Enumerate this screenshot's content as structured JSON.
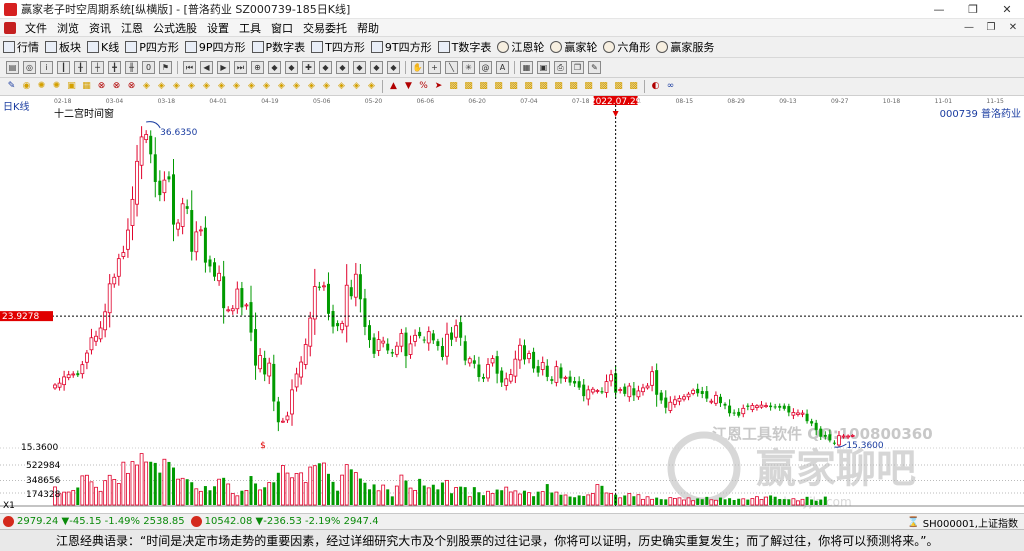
{
  "window": {
    "title": "赢家老子时空周期系统[纵横版] - [普洛药业  SZ000739-185日K线]",
    "buttons": [
      "—",
      "❐",
      "✕"
    ]
  },
  "menubar": {
    "items": [
      "文件",
      "浏览",
      "资讯",
      "江恩",
      "公式选股",
      "设置",
      "工具",
      "窗口",
      "交易委托",
      "帮助"
    ],
    "mdi_buttons": [
      "—",
      "❐",
      "✕"
    ]
  },
  "toolbar1": {
    "items": [
      {
        "icon": "grid-icon",
        "label": "行情"
      },
      {
        "icon": "blocks-icon",
        "label": "板块"
      },
      {
        "icon": "candle-icon",
        "label": "K线"
      },
      {
        "icon": "square-p-icon",
        "label": "P四方形"
      },
      {
        "icon": "square-9p-icon",
        "label": "9P四方形"
      },
      {
        "icon": "square-pn-icon",
        "label": "P数字表"
      },
      {
        "icon": "square-t-icon",
        "label": "T四方形"
      },
      {
        "icon": "square-9t-icon",
        "label": "9T四方形"
      },
      {
        "icon": "square-tn-icon",
        "label": "T数字表"
      },
      {
        "icon": "wheel-icon",
        "label": "江恩轮"
      },
      {
        "icon": "wheel2-icon",
        "label": "赢家轮"
      },
      {
        "icon": "hexagon-icon",
        "label": "六角形"
      },
      {
        "icon": "service-icon",
        "label": "赢家服务"
      }
    ]
  },
  "toolbar2": {
    "zero_label": "0"
  },
  "chart": {
    "period_label": "日K线",
    "window_title": "十二宫时间窗",
    "stock_label": "000739 普洛药业",
    "cursor_date": "2022.07.29",
    "cursor_price": "23.9278",
    "high_label": "36.6350",
    "low_label": "15.3600",
    "price_axis_label": "15.3600",
    "vol_labels": [
      "522984",
      "348656",
      "174328"
    ],
    "vol_unit": "X1",
    "watermark_text": "江恩工具软件 QQ:100800360",
    "watermark_brand": "赢家聊吧",
    "watermark_url": "liaoba.yjlz.com",
    "date_ticks": [
      "02-18",
      "03-04",
      "03-18",
      "04-01",
      "04-19",
      "05-06",
      "05-20",
      "06-06",
      "06-20",
      "07-04",
      "07-18",
      "08-01",
      "08-15",
      "08-29",
      "09-13",
      "09-27",
      "10-18",
      "11-01",
      "11-15"
    ],
    "colors": {
      "up": "#e0002a",
      "down": "#009a00",
      "crosshair": "#000000",
      "price_tag": "#e00000"
    }
  },
  "chart_data": {
    "type": "candlestick",
    "ylim": [
      15.36,
      36.635
    ],
    "closes": [
      19.42,
      19.54,
      19.95,
      20.09,
      20.14,
      20.06,
      20.75,
      21.51,
      22.51,
      22.61,
      23.15,
      24.21,
      26.04,
      26.47,
      27.69,
      28.09,
      29.56,
      31.57,
      34.06,
      35.66,
      35.82,
      34.52,
      32.71,
      31.85,
      32.83,
      32.88,
      29.92,
      30.02,
      31.28,
      30.95,
      28.14,
      29.44,
      29.57,
      27.43,
      27.18,
      26.51,
      26.73,
      24.45,
      24.34,
      24.41,
      25.7,
      24.5,
      24.66,
      22.85,
      20.69,
      21.35,
      20.11,
      20.85,
      18.34,
      16.98,
      17.05,
      17.39,
      19.1,
      20.14,
      20.92,
      22.07,
      23.8,
      25.86,
      25.78,
      25.91,
      24.08,
      23.24,
      23.27,
      23.45,
      25.95,
      25.23,
      26.67,
      25.03,
      23.22,
      22.36,
      21.46,
      22.39,
      22.29,
      21.68,
      21.48,
      21.96,
      22.79,
      21.31,
      22.11,
      22.67,
      22.62,
      22.34,
      22.91,
      22.34,
      21.97,
      21.25,
      22.74,
      22.38,
      23.3,
      22.51,
      21.02,
      21.14,
      20.81,
      19.94,
      19.83,
      20.76,
      21.15,
      20.16,
      19.58,
      19.82,
      20.1,
      21.11,
      22.02,
      21.09,
      21.48,
      20.5,
      20.23,
      20.89,
      19.95,
      19.69,
      20.62,
      19.85,
      19.92,
      19.58,
      19.52,
      19.25,
      18.69,
      19.1,
      19.14,
      19.06,
      18.93,
      19.64,
      20.09,
      18.92,
      19.12,
      18.84,
      19.35,
      18.74,
      19.03,
      19.23,
      19.35,
      20.29,
      18.78,
      18.41,
      17.93,
      18.29,
      18.45,
      18.54,
      18.65,
      18.82,
      19.07,
      18.88,
      18.83,
      18.53,
      18.36,
      18.74,
      18.23,
      18.07,
      17.57,
      17.57,
      17.41,
      17.89,
      17.99,
      18.08,
      18.06,
      18.1,
      18.07,
      17.97,
      17.96,
      17.93,
      17.86,
      17.62,
      17.62,
      17.59,
      17.58,
      17.05,
      16.9,
      16.48,
      16.03,
      16.03,
      15.8,
      15.61,
      16.1,
      16.08,
      16.08,
      16.12
    ],
    "volumes": [
      145500,
      90500,
      103700,
      104400,
      117000,
      141000,
      234700,
      239600,
      186600,
      142800,
      110200,
      196100,
      239200,
      206000,
      173300,
      345000,
      254700,
      350000,
      322100,
      414300,
      346100,
      348200,
      339000,
      260800,
      368600,
      346800,
      301800,
      208200,
      215000,
      207800,
      183400,
      130500,
      110000,
      152400,
      118700,
      150800,
      207900,
      219000,
      169500,
      92300,
      74000,
      115200,
      117500,
      233300,
      173500,
      121400,
      142800,
      181000,
      182800,
      259600,
      318700,
      257300,
      219400,
      254400,
      258900,
      180600,
      305900,
      316600,
      335900,
      338200,
      251000,
      186500,
      115300,
      240800,
      325300,
      287300,
      261100,
      213200,
      179300,
      126400,
      165800,
      114600,
      160700,
      126100,
      69600,
      152800,
      241000,
      196800,
      136500,
      117400,
      210500,
      156700,
      137900,
      163300,
      126000,
      181100,
      198300,
      94700,
      140900,
      148000,
      143900,
      66900,
      144000,
      102600,
      79300,
      110500,
      93600,
      124400,
      118900,
      144100,
      104900,
      113900,
      88400,
      115300,
      99500,
      71000,
      107400,
      108200,
      168500,
      100500,
      104100,
      82800,
      80800,
      68100,
      62600,
      77100,
      72700,
      81500,
      92800,
      164700,
      154400,
      97000,
      93300,
      83200,
      57800,
      76800,
      92500,
      70700,
      83100,
      45400,
      66500,
      45700,
      59600,
      47200,
      45300,
      59500,
      53300,
      57600,
      40500,
      57600,
      34800,
      53100,
      46600,
      65600,
      42200,
      38100,
      59800,
      45800,
      54700,
      40400,
      50400,
      49900,
      43600,
      51800,
      67000,
      44300,
      63900,
      77100,
      66500,
      48500,
      47400,
      45900,
      50600,
      33600,
      45700,
      65900,
      44500,
      34400,
      43200,
      67700
    ],
    "high": 36.635,
    "low": 15.36,
    "cursor_price": 23.9278
  },
  "statusbar": {
    "sh_index": "2979.24",
    "sh_change": "▼-45.15",
    "sh_pct": "-1.49%",
    "sh_amount": "2538.85",
    "sz_index": "10542.08",
    "sz_change": "▼-236.53",
    "sz_pct": "-2.19%",
    "sz_amount": "2947.4",
    "right_code": "SH000001,上证指数"
  },
  "quotebar": {
    "text": "江恩经典语录：“时间是决定市场走势的重要因素，经过详细研究大市及个别股票的过往记录，你将可以证明，历史确实重复发生；而了解过往，你将可以预测将来。”。"
  }
}
